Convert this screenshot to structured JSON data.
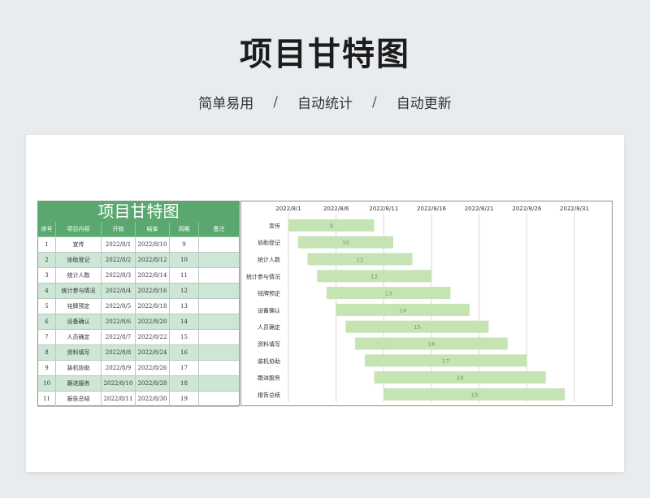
{
  "header": {
    "title": "项目甘特图",
    "tags": [
      "简单易用",
      "自动统计",
      "自动更新"
    ],
    "separator": "/"
  },
  "table": {
    "title": "项目甘特图",
    "columns": [
      "序号",
      "项目内容",
      "开始",
      "结束",
      "周期",
      "备注"
    ],
    "rows": [
      [
        "1",
        "宣传",
        "2022/8/1",
        "2022/8/10",
        "9",
        ""
      ],
      [
        "2",
        "协助登记",
        "2022/8/2",
        "2022/8/12",
        "10",
        ""
      ],
      [
        "3",
        "统计人数",
        "2022/8/3",
        "2022/8/14",
        "11",
        ""
      ],
      [
        "4",
        "统计参与情况",
        "2022/8/4",
        "2022/8/16",
        "12",
        ""
      ],
      [
        "5",
        "铭牌预定",
        "2022/8/5",
        "2022/8/18",
        "13",
        ""
      ],
      [
        "6",
        "设备确认",
        "2022/8/6",
        "2022/8/20",
        "14",
        ""
      ],
      [
        "7",
        "人员确定",
        "2022/8/7",
        "2022/8/22",
        "15",
        ""
      ],
      [
        "8",
        "资料填写",
        "2022/8/8",
        "2022/8/24",
        "16",
        ""
      ],
      [
        "9",
        "装机协助",
        "2022/8/9",
        "2022/8/26",
        "17",
        ""
      ],
      [
        "10",
        "跟进服务",
        "2022/8/10",
        "2022/8/28",
        "18",
        ""
      ],
      [
        "11",
        "报告总结",
        "2022/8/11",
        "2022/8/30",
        "19",
        ""
      ]
    ],
    "header_color": "#5aa86f",
    "alt_row_color": "#cde6d5"
  },
  "chart_data": {
    "type": "bar",
    "orientation": "horizontal-gantt",
    "x_ticks": [
      "2022/8/1",
      "2022/8/6",
      "2022/8/11",
      "2022/8/16",
      "2022/8/21",
      "2022/8/26",
      "2022/8/31"
    ],
    "categories": [
      "宣传",
      "协助登记",
      "统计人数",
      "统计参与情况",
      "铭牌预定",
      "设备确认",
      "人员确定",
      "资料填写",
      "装机协助",
      "跟进服务",
      "报告总结"
    ],
    "start": [
      "2022/8/1",
      "2022/8/2",
      "2022/8/3",
      "2022/8/4",
      "2022/8/5",
      "2022/8/6",
      "2022/8/7",
      "2022/8/8",
      "2022/8/9",
      "2022/8/10",
      "2022/8/11"
    ],
    "duration": [
      9,
      10,
      11,
      12,
      13,
      14,
      15,
      16,
      17,
      18,
      19
    ],
    "bar_color": "#c6e3b4",
    "label_color": "#7a9a7a",
    "xlim": [
      "2022/8/1",
      "2022/8/31"
    ],
    "grid": true
  }
}
